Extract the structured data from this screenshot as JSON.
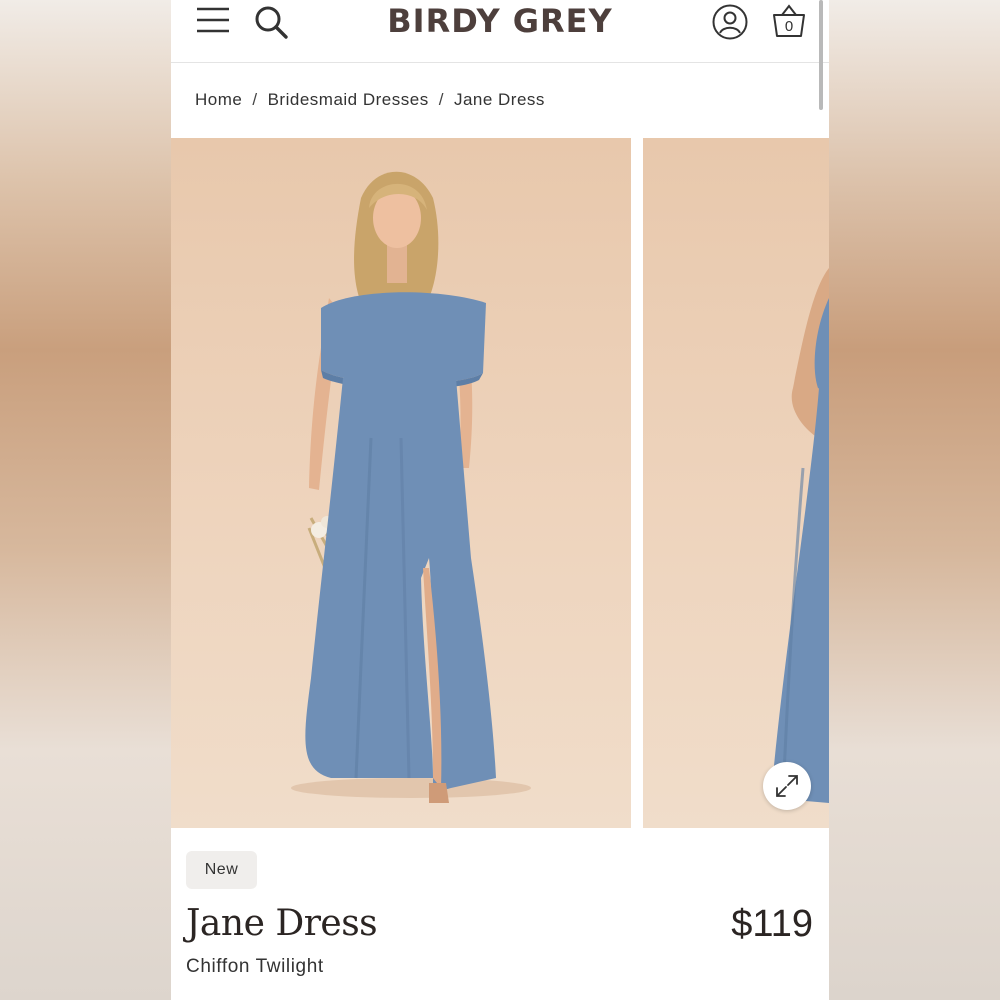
{
  "header": {
    "brand": "BIRDY GREY",
    "cart_count": "0"
  },
  "icons": {
    "menu": "hamburger-menu-icon",
    "search": "search-icon",
    "account": "account-icon",
    "cart": "shopping-bag-icon",
    "expand": "expand-icon"
  },
  "breadcrumb": {
    "items": [
      "Home",
      "Bridesmaid Dresses",
      "Jane Dress"
    ],
    "separator": "/"
  },
  "product": {
    "badge": "New",
    "name": "Jane Dress",
    "price": "$119",
    "variant": "Chiffon Twilight"
  },
  "colors": {
    "dress": "#6f8fb6",
    "brand_text": "#4d3f3c",
    "photo_bg": "#ebd0b8"
  }
}
